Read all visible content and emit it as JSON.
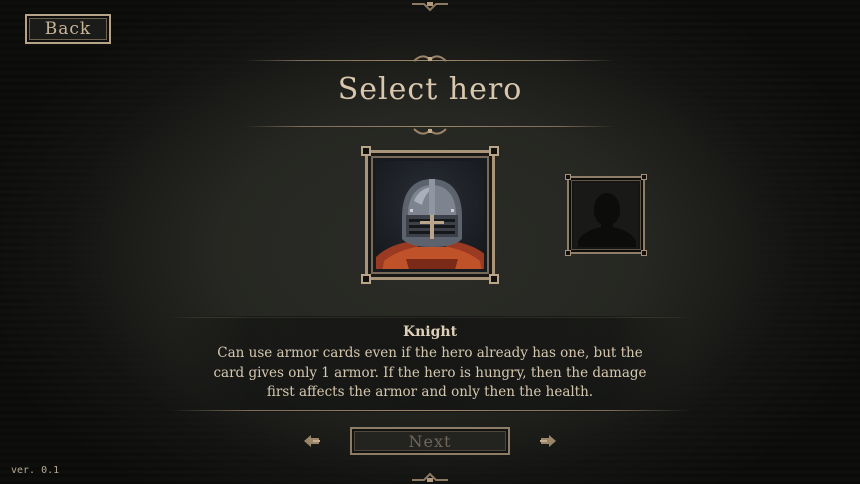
{
  "screen": {
    "title": "Select hero",
    "version": "ver. 0.1"
  },
  "nav": {
    "back_label": "Back",
    "next_label": "Next",
    "prev_arrow_icon": "left-arrow-ornament-icon",
    "next_arrow_icon": "right-arrow-ornament-icon"
  },
  "heroes": [
    {
      "name": "Knight",
      "state": "selected",
      "portrait_icon": "knight-helmet-icon"
    },
    {
      "name": "",
      "state": "locked",
      "portrait_icon": "silhouette-icon"
    }
  ],
  "selected_hero": {
    "name": "Knight",
    "description_lines": [
      "Can use armor cards even if the hero already has one, but the",
      "card gives only 1 armor. If the hero is hungry, then the damage",
      "first affects the armor and only then the health."
    ]
  },
  "colors": {
    "background": "#262722",
    "frame": "#a89478",
    "text": "#d8c7ad",
    "disabled_text": "#6f6659"
  }
}
